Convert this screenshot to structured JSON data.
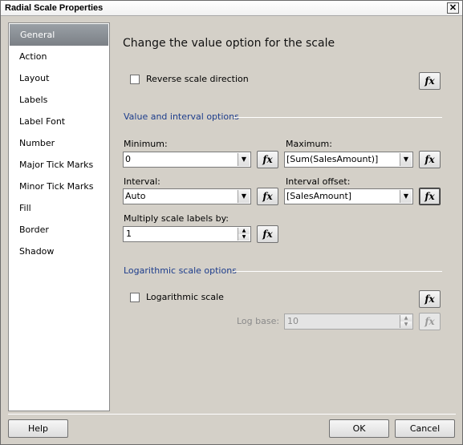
{
  "window": {
    "title": "Radial Scale Properties",
    "close_glyph": "✕"
  },
  "nav": {
    "items": [
      {
        "label": "General",
        "selected": true
      },
      {
        "label": "Action"
      },
      {
        "label": "Layout"
      },
      {
        "label": "Labels"
      },
      {
        "label": "Label Font"
      },
      {
        "label": "Number"
      },
      {
        "label": "Major Tick Marks"
      },
      {
        "label": "Minor Tick Marks"
      },
      {
        "label": "Fill"
      },
      {
        "label": "Border"
      },
      {
        "label": "Shadow"
      }
    ]
  },
  "page": {
    "title": "Change the value option for the scale",
    "reverse_scale": {
      "label": "Reverse scale direction",
      "checked": false
    },
    "value_section": {
      "heading": "Value and interval options",
      "minimum": {
        "label": "Minimum:",
        "value": "0"
      },
      "maximum": {
        "label": "Maximum:",
        "value": "[Sum(SalesAmount)]"
      },
      "interval": {
        "label": "Interval:",
        "value": "Auto"
      },
      "interval_offset": {
        "label": "Interval offset:",
        "value": "[SalesAmount]"
      },
      "multiply": {
        "label": "Multiply scale labels by:",
        "value": "1"
      }
    },
    "log_section": {
      "heading": "Logarithmic scale options",
      "log_scale": {
        "label": "Logarithmic scale",
        "checked": false
      },
      "log_base": {
        "label": "Log base:",
        "value": "10",
        "enabled": false
      }
    },
    "fx_label": "fx"
  },
  "footer": {
    "help": "Help",
    "ok": "OK",
    "cancel": "Cancel"
  },
  "colors": {
    "section_heading": "#1d3d8c",
    "nav_selected": "#8a8f95",
    "dialog_bg": "#d4d0c8"
  },
  "icons": {
    "expression": "fx-icon",
    "dropdown": "chevron-down-icon",
    "close": "close-icon"
  }
}
